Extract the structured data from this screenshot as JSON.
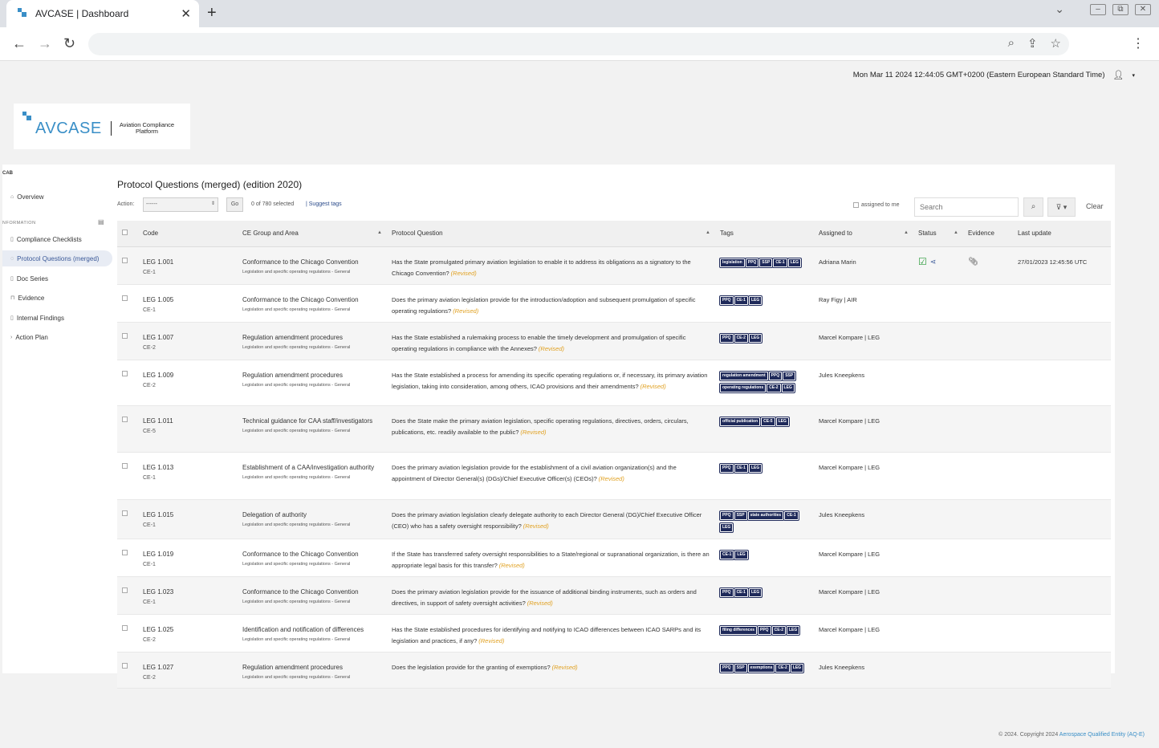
{
  "browser": {
    "tab_title": "AVCASE",
    "tab_subtitle": "Dashboard",
    "new_tab": "+",
    "close": "✕"
  },
  "page": {
    "datetime": "Mon Mar 11 2024 12:44:05 GMT+0200 (Eastern European Standard Time)",
    "logo_text": "AVCASE",
    "logo_sub": "Aviation Compliance Platform",
    "footer_prefix": "© 2024.  Copyright 2024",
    "footer_link": "Aerospace Qualified Entity (AQ-E)"
  },
  "sidebar": {
    "head": "CAB",
    "section": "NFORMATION",
    "items": [
      {
        "label": "Overview"
      },
      {
        "label": "Compliance Checklists"
      },
      {
        "label": "Protocol Questions (merged)"
      },
      {
        "label": "Doc Series"
      },
      {
        "label": "Evidence"
      },
      {
        "label": "Internal Findings"
      },
      {
        "label": "Action Plan"
      }
    ]
  },
  "main": {
    "title": "Protocol Questions (merged) (edition 2020)",
    "action_label": "Action:",
    "action_value": "------",
    "go": "Go",
    "selected_count": "0 of 780 selected",
    "suggest_tags": "| Suggest tags",
    "assigned_to_me": "assigned to me",
    "search_placeholder": "Search",
    "clear": "Clear",
    "columns": [
      "Code",
      "CE Group and Area",
      "Protocol Question",
      "Tags",
      "Assigned to",
      "Status",
      "Evidence",
      "Last update"
    ],
    "rows": [
      {
        "code": "LEG 1.001",
        "ce": "CE-1",
        "group": "Conformance to the Chicago Convention",
        "sub": "Legislation and specific operating regulations - General",
        "question": "Has the State promulgated primary aviation legislation to enable it to address its obligations as a signatory to the Chicago Convention?",
        "revised": "(Revised)",
        "tags": [
          "legislation",
          "PPQ",
          "SSP",
          "CE-1",
          "LEG"
        ],
        "assigned": "Adriana Marin",
        "status": true,
        "evidence": true,
        "updated": "27/01/2023 12:45:56 UTC"
      },
      {
        "code": "LEG 1.005",
        "ce": "CE-1",
        "group": "Conformance to the Chicago Convention",
        "sub": "Legislation and specific operating regulations - General",
        "question": "Does the primary aviation legislation provide for the introduction/adoption and subsequent promulgation of specific operating regulations?",
        "revised": "(Revised)",
        "tags": [
          "PPQ",
          "CE-1",
          "LEG"
        ],
        "assigned": "Ray Figy | AIR",
        "status": false,
        "evidence": false,
        "updated": ""
      },
      {
        "code": "LEG 1.007",
        "ce": "CE-2",
        "group": "Regulation amendment procedures",
        "sub": "Legislation and specific operating regulations - General",
        "question": "Has the State established a rulemaking process to enable the timely development and promulgation of specific operating regulations in compliance with the Annexes?",
        "revised": "(Revised)",
        "tags": [
          "PPQ",
          "CE-2",
          "LEG"
        ],
        "assigned": "Marcel Kompare | LEG",
        "status": false,
        "evidence": false,
        "updated": ""
      },
      {
        "code": "LEG 1.009",
        "ce": "CE-2",
        "group": "Regulation amendment procedures",
        "sub": "Legislation and specific operating regulations - General",
        "question": "Has the State established a process for amending its specific operating regulations or, if necessary, its primary aviation legislation, taking into consideration, among others, ICAO provisions and their amendments?",
        "revised": "(Revised)",
        "tags": [
          "regulation amendment",
          "PPQ",
          "SSP",
          "operating regulations",
          "CE-2",
          "LEG"
        ],
        "assigned": "Jules Kneepkens",
        "status": false,
        "evidence": false,
        "updated": ""
      },
      {
        "code": "LEG 1.011",
        "ce": "CE-5",
        "group": "Technical guidance for CAA staff/investigators",
        "sub": "Legislation and specific operating regulations - General",
        "question": "Does the State make the primary aviation legislation, specific operating regulations, directives, orders, circulars, publications, etc. readily available to the public?",
        "revised": "(Revised)",
        "tags": [
          "official publication",
          "CE-5",
          "LEG"
        ],
        "assigned": "Marcel Kompare | LEG",
        "status": false,
        "evidence": false,
        "updated": ""
      },
      {
        "code": "LEG 1.013",
        "ce": "CE-1",
        "group": "Establishment of a CAA/investigation authority",
        "sub": "Legislation and specific operating regulations - General",
        "question": "Does the primary aviation legislation provide for the establishment of a civil aviation organization(s) and the appointment of Director General(s) (DGs)/Chief Executive Officer(s) (CEOs)?",
        "revised": "(Revised)",
        "tags": [
          "PPQ",
          "CE-1",
          "LEG"
        ],
        "assigned": "Marcel Kompare | LEG",
        "status": false,
        "evidence": false,
        "updated": ""
      },
      {
        "code": "LEG 1.015",
        "ce": "CE-1",
        "group": "Delegation of authority",
        "sub": "Legislation and specific operating regulations - General",
        "question": "Does the primary aviation legislation clearly delegate authority to each Director General (DG)/Chief Executive Officer (CEO) who has a safety oversight responsibility?",
        "revised": "(Revised)",
        "tags": [
          "PPQ",
          "SSP",
          "state authorities",
          "CE-1",
          "LEG"
        ],
        "assigned": "Jules Kneepkens",
        "status": false,
        "evidence": false,
        "updated": ""
      },
      {
        "code": "LEG 1.019",
        "ce": "CE-1",
        "group": "Conformance to the Chicago Convention",
        "sub": "Legislation and specific operating regulations - General",
        "question": "If the State has transferred safety oversight responsibilities to a State/regional or supranational organization, is there an appropriate legal basis for this transfer?",
        "revised": "(Revised)",
        "tags": [
          "CE-1",
          "LEG"
        ],
        "assigned": "Marcel Kompare | LEG",
        "status": false,
        "evidence": false,
        "updated": ""
      },
      {
        "code": "LEG 1.023",
        "ce": "CE-1",
        "group": "Conformance to the Chicago Convention",
        "sub": "Legislation and specific operating regulations - General",
        "question": "Does the primary aviation legislation provide for the issuance of additional binding instruments, such as orders and directives, in support of safety oversight activities?",
        "revised": "(Revised)",
        "tags": [
          "PPQ",
          "CE-1",
          "LEG"
        ],
        "assigned": "Marcel Kompare | LEG",
        "status": false,
        "evidence": false,
        "updated": ""
      },
      {
        "code": "LEG 1.025",
        "ce": "CE-2",
        "group": "Identification and notification of differences",
        "sub": "Legislation and specific operating regulations - General",
        "question": "Has the State established procedures for identifying and notifying to ICAO differences between ICAO SARPs and its legislation and practices, if any?",
        "revised": "(Revised)",
        "tags": [
          "filing differences",
          "PPQ",
          "CE-2",
          "LEG"
        ],
        "assigned": "Marcel Kompare | LEG",
        "status": false,
        "evidence": false,
        "updated": ""
      },
      {
        "code": "LEG 1.027",
        "ce": "CE-2",
        "group": "Regulation amendment procedures",
        "sub": "Legislation and specific operating regulations - General",
        "question": "Does the legislation provide for the granting of exemptions?",
        "revised": "(Revised)",
        "tags": [
          "PPQ",
          "SSP",
          "exemptions",
          "CE-2",
          "LEG"
        ],
        "assigned": "Jules Kneepkens",
        "status": false,
        "evidence": false,
        "updated": ""
      }
    ]
  },
  "colors": {
    "brand": "#3a8fc7",
    "tag_bg": "#1f2a5a",
    "revised": "#e0a020",
    "status_ok": "#2a9a3a"
  }
}
